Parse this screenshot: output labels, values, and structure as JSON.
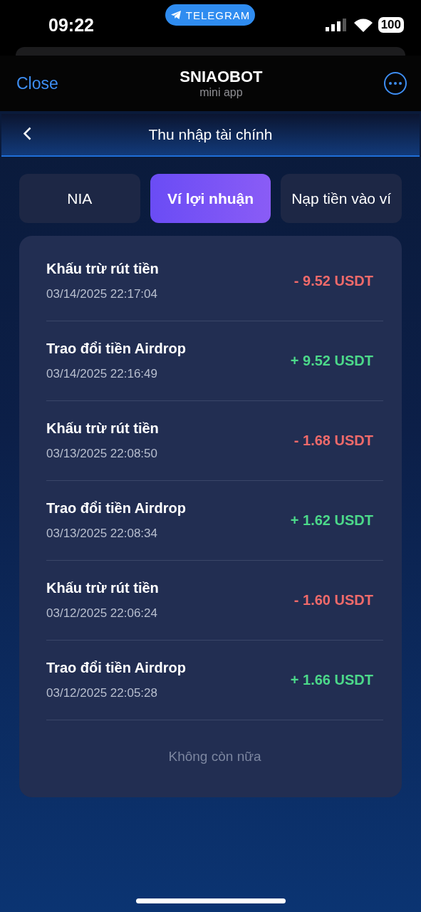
{
  "status_bar": {
    "time": "09:22",
    "pill": "TELEGRAM",
    "battery": "100"
  },
  "telegram_header": {
    "close": "Close",
    "title": "SNIAOBOT",
    "subtitle": "mini app"
  },
  "page_header": {
    "title": "Thu nhập tài chính"
  },
  "tabs": [
    {
      "label": "NIA",
      "selected": false
    },
    {
      "label": "Ví lợi nhuận",
      "selected": true
    },
    {
      "label": "Nạp tiền vào ví",
      "selected": false
    }
  ],
  "transactions": [
    {
      "title": "Khấu trừ rút tiền",
      "time": "03/14/2025 22:17:04",
      "amount": "- 9.52 USDT",
      "kind": "debit"
    },
    {
      "title": "Trao đổi tiền Airdrop",
      "time": "03/14/2025 22:16:49",
      "amount": "+ 9.52 USDT",
      "kind": "credit"
    },
    {
      "title": "Khấu trừ rút tiền",
      "time": "03/13/2025 22:08:50",
      "amount": "- 1.68 USDT",
      "kind": "debit"
    },
    {
      "title": "Trao đổi tiền Airdrop",
      "time": "03/13/2025 22:08:34",
      "amount": "+ 1.62 USDT",
      "kind": "credit"
    },
    {
      "title": "Khấu trừ rút tiền",
      "time": "03/12/2025 22:06:24",
      "amount": "- 1.60 USDT",
      "kind": "debit"
    },
    {
      "title": "Trao đổi tiền Airdrop",
      "time": "03/12/2025 22:05:28",
      "amount": "+ 1.66 USDT",
      "kind": "credit"
    }
  ],
  "end_note": "Không còn nữa"
}
